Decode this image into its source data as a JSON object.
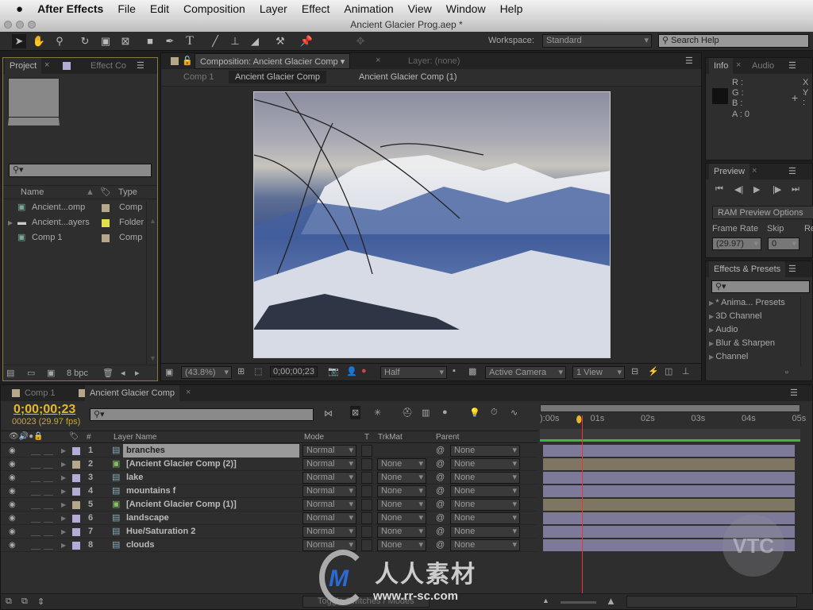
{
  "menubar": {
    "app": "After Effects",
    "items": [
      "File",
      "Edit",
      "Composition",
      "Layer",
      "Effect",
      "Animation",
      "View",
      "Window",
      "Help"
    ]
  },
  "window": {
    "title": "Ancient Glacier Prog.aep *"
  },
  "toolbar": {
    "workspace_label": "Workspace:",
    "workspace_value": "Standard",
    "search_placeholder": "Search Help"
  },
  "project": {
    "tabs": [
      "Project",
      "Effect Co"
    ],
    "columns": [
      "Name",
      "Type"
    ],
    "items": [
      {
        "name": "Ancient...omp",
        "type": "Comp",
        "color": "#b5a88a",
        "icon": "comp-icon"
      },
      {
        "name": "Ancient...ayers",
        "type": "Folder",
        "color": "#e3e04a",
        "icon": "folder-icon"
      },
      {
        "name": "Comp 1",
        "type": "Comp",
        "color": "#b5a88a",
        "icon": "comp-icon"
      }
    ],
    "bpc": "8 bpc"
  },
  "composition": {
    "tab": "Composition: Ancient Glacier Comp",
    "layer_tab": "Layer: (none)",
    "breadcrumbs": [
      "Comp 1",
      "Ancient Glacier Comp",
      "Ancient Glacier Comp (1)"
    ],
    "zoom": "(43.8%)",
    "timecode": "0;00;00;23",
    "resolution": "Half",
    "camera": "Active Camera",
    "views": "1 View"
  },
  "info": {
    "tabs": [
      "Info",
      "Audio"
    ],
    "r": "R :",
    "g": "G :",
    "b": "B :",
    "a": "A : 0",
    "x": "X :",
    "y": "Y :"
  },
  "preview": {
    "tab": "Preview",
    "ram_button": "RAM Preview Options",
    "frame_rate_label": "Frame Rate",
    "skip_label": "Skip",
    "res_label": "Re",
    "frame_rate": "(29.97)",
    "skip": "0"
  },
  "effects": {
    "tab": "Effects & Presets",
    "items": [
      "* Anima... Presets",
      "3D Channel",
      "Audio",
      "Blur & Sharpen",
      "Channel"
    ]
  },
  "timeline": {
    "tabs": [
      "Comp 1",
      "Ancient Glacier Comp"
    ],
    "timecode": "0;00;00;23",
    "frames": "00023 (29.97 fps)",
    "columns": {
      "num": "#",
      "name": "Layer Name",
      "mode": "Mode",
      "t": "T",
      "trkmat": "TrkMat",
      "parent": "Parent"
    },
    "ruler": [
      "):00s",
      "01s",
      "02s",
      "03s",
      "04s",
      "05s"
    ],
    "current_time_fraction": 0.153,
    "layers": [
      {
        "num": "1",
        "name": "branches",
        "mode": "Normal",
        "trkmat": "",
        "parent": "None",
        "color": "#b4abd6",
        "type": "footage",
        "selected": true
      },
      {
        "num": "2",
        "name": "[Ancient Glacier Comp (2)]",
        "mode": "Normal",
        "trkmat": "None",
        "parent": "None",
        "color": "#b5a88a",
        "type": "comp"
      },
      {
        "num": "3",
        "name": "lake",
        "mode": "Normal",
        "trkmat": "None",
        "parent": "None",
        "color": "#b4abd6",
        "type": "footage"
      },
      {
        "num": "4",
        "name": "mountains f",
        "mode": "Normal",
        "trkmat": "None",
        "parent": "None",
        "color": "#b4abd6",
        "type": "footage"
      },
      {
        "num": "5",
        "name": "[Ancient Glacier Comp (1)]",
        "mode": "Normal",
        "trkmat": "None",
        "parent": "None",
        "color": "#b5a88a",
        "type": "comp"
      },
      {
        "num": "6",
        "name": "landscape",
        "mode": "Normal",
        "trkmat": "None",
        "parent": "None",
        "color": "#b4abd6",
        "type": "footage"
      },
      {
        "num": "7",
        "name": "Hue/Saturation 2",
        "mode": "Normal",
        "trkmat": "None",
        "parent": "None",
        "color": "#b4abd6",
        "type": "footage"
      },
      {
        "num": "8",
        "name": "clouds",
        "mode": "Normal",
        "trkmat": "None",
        "parent": "None",
        "color": "#b4abd6",
        "type": "footage"
      }
    ],
    "toggle_button": "Toggle Switches / Modes"
  },
  "watermark": {
    "text": "人人素材",
    "url": "www.rr-sc.com",
    "vtc": "VTC"
  },
  "colors": {
    "accent": "#e3b82a",
    "panel": "#2e2e2e",
    "timecode": "#e3b82a"
  }
}
